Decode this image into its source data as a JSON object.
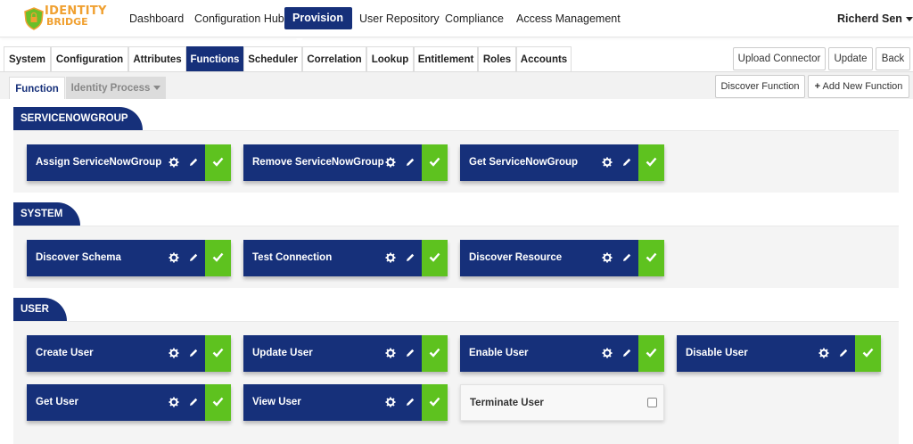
{
  "brand": {
    "line1": "IDENTITY",
    "line2": "BRIDGE",
    "colors": {
      "orange": "#f0a030",
      "green": "#5ec21f"
    }
  },
  "nav": {
    "items": [
      "Dashboard",
      "Configuration Hub",
      "Provision",
      "User Repository",
      "Compliance",
      "Access Management"
    ],
    "active": "Configuration Hub",
    "selected": "Provision",
    "user": "Richerd Sen"
  },
  "tabs": {
    "items": [
      "System",
      "Configuration",
      "Attributes",
      "Functions",
      "Scheduler",
      "Correlation",
      "Lookup",
      "Entitlement",
      "Roles",
      "Accounts"
    ],
    "active": "Functions"
  },
  "actions": {
    "upload": "Upload Connector",
    "update": "Update",
    "back": "Back",
    "discover_function": "Discover Function",
    "add_new_function": "Add New Function"
  },
  "subtabs": {
    "items": [
      "Function",
      "Identity Process"
    ],
    "active": "Function"
  },
  "sections": [
    {
      "title": "SERVICENOWGROUP",
      "functions": [
        {
          "label": "Assign ServiceNowGroup",
          "enabled": true
        },
        {
          "label": "Remove ServiceNowGroup",
          "enabled": true
        },
        {
          "label": "Get ServiceNowGroup",
          "enabled": true
        }
      ]
    },
    {
      "title": "SYSTEM",
      "functions": [
        {
          "label": "Discover Schema",
          "enabled": true
        },
        {
          "label": "Test Connection",
          "enabled": true
        },
        {
          "label": "Discover Resource",
          "enabled": true
        }
      ]
    },
    {
      "title": "USER",
      "functions": [
        {
          "label": "Create User",
          "enabled": true
        },
        {
          "label": "Update User",
          "enabled": true
        },
        {
          "label": "Enable User",
          "enabled": true
        },
        {
          "label": "Disable User",
          "enabled": true
        },
        {
          "label": "Get User",
          "enabled": true
        },
        {
          "label": "View User",
          "enabled": true
        },
        {
          "label": "Terminate User",
          "enabled": false
        }
      ]
    }
  ],
  "colors": {
    "primary": "#16307a",
    "enabled": "#5ec21f"
  }
}
